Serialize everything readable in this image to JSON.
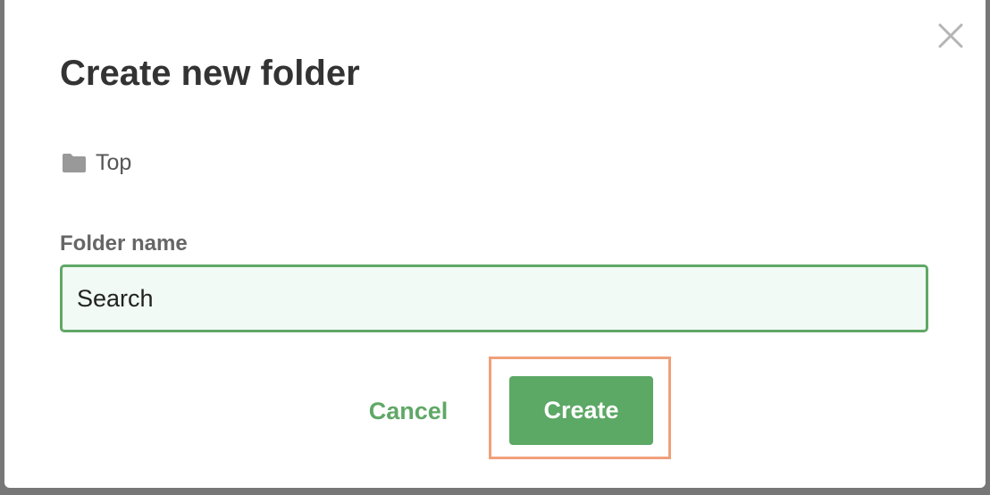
{
  "dialog": {
    "title": "Create new folder",
    "close_icon": "close-icon",
    "location": {
      "icon": "folder-icon",
      "label": "Top"
    },
    "field": {
      "label": "Folder name",
      "value": "Search"
    },
    "actions": {
      "cancel_label": "Cancel",
      "create_label": "Create"
    }
  },
  "colors": {
    "accent_green": "#5ca865",
    "input_background": "#f1faf5",
    "highlight_orange": "#f0a07a",
    "title_text": "#333333"
  }
}
